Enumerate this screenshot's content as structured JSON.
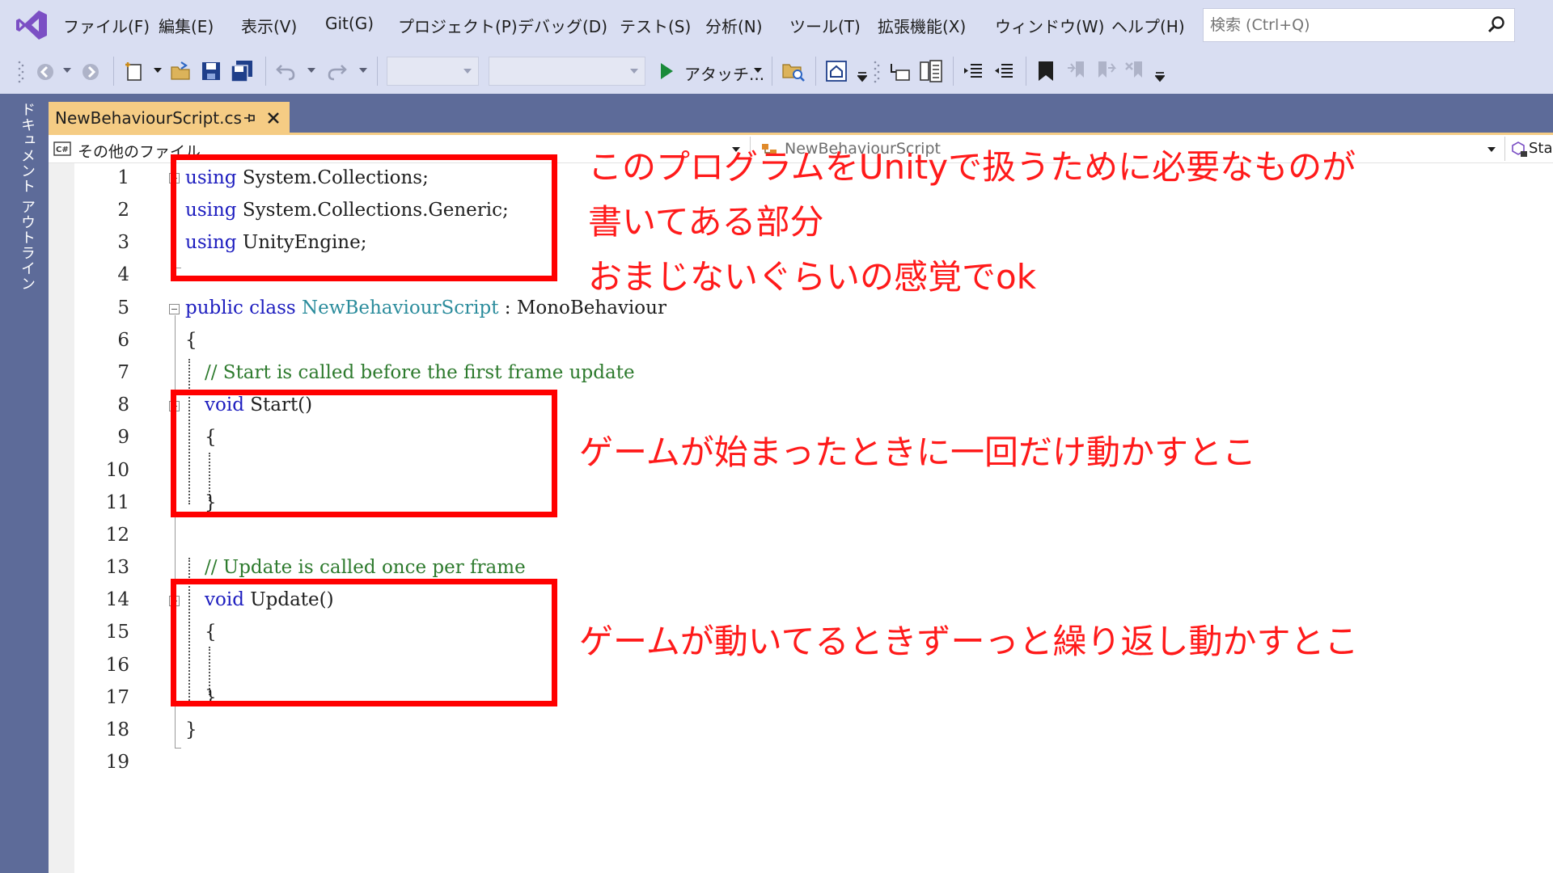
{
  "menu": {
    "items": [
      "ファイル(F)",
      "編集(E)",
      "表示(V)",
      "Git(G)",
      "プロジェクト(P)",
      "デバッグ(D)",
      "テスト(S)",
      "分析(N)",
      "ツール(T)",
      "拡張機能(X)",
      "ウィンドウ(W)",
      "ヘルプ(H)"
    ],
    "search_placeholder": "検索 (Ctrl+Q)"
  },
  "toolbar": {
    "attach_label": "アタッチ...",
    "icons": [
      "back-icon",
      "forward-icon",
      "new-item-icon",
      "open-folder-icon",
      "save-icon",
      "save-all-icon",
      "undo-icon",
      "redo-icon",
      "start-icon",
      "find-in-files-icon",
      "home-icon",
      "indent-icon",
      "bookmark-icon"
    ]
  },
  "side_panel": {
    "label": "ドキュメント アウトライン"
  },
  "document_tab": {
    "title": "NewBehaviourScript.cs"
  },
  "nav_bar": {
    "project": "その他のファイル",
    "class": "NewBehaviourScript",
    "member": "Start()"
  },
  "editor": {
    "line_numbers": [
      "1",
      "2",
      "3",
      "4",
      "5",
      "6",
      "7",
      "8",
      "9",
      "10",
      "11",
      "12",
      "13",
      "14",
      "15",
      "16",
      "17",
      "18",
      "19"
    ],
    "lines": {
      "l1_kw": "using",
      "l1_rest": " System.Collections;",
      "l2_kw": "using",
      "l2_rest": " System.Collections.Generic;",
      "l3_kw": "using",
      "l3_rest": " UnityEngine;",
      "l5_kw": "public class",
      "l5_cls": " NewBehaviourScript",
      "l5_rest": " : MonoBehaviour",
      "l6": "{",
      "l7": "// Start is called before the first frame update",
      "l8_kw": "void",
      "l8_rest": " Start()",
      "l9": "{",
      "l11": "}",
      "l13": "// Update is called once per frame",
      "l14_kw": "void",
      "l14_rest": " Update()",
      "l15": "{",
      "l17": "}",
      "l18": "}"
    }
  },
  "annotations": {
    "using_note_1": "このプログラムをUnityで扱うために必要なものが",
    "using_note_2": "書いてある部分",
    "using_note_3": "おまじないぐらいの感覚でok",
    "start_note": "ゲームが始まったときに一回だけ動かすとこ",
    "update_note": "ゲームが動いてるときずーっと繰り返し動かすとこ"
  },
  "colors": {
    "chrome": "#d9def2",
    "frame": "#5d6b99",
    "active_tab": "#f5cc84",
    "keyword": "#1d1dbf",
    "class_name": "#2b8c9c",
    "comment": "#2d7a2d",
    "annotation": "#ff0000"
  }
}
